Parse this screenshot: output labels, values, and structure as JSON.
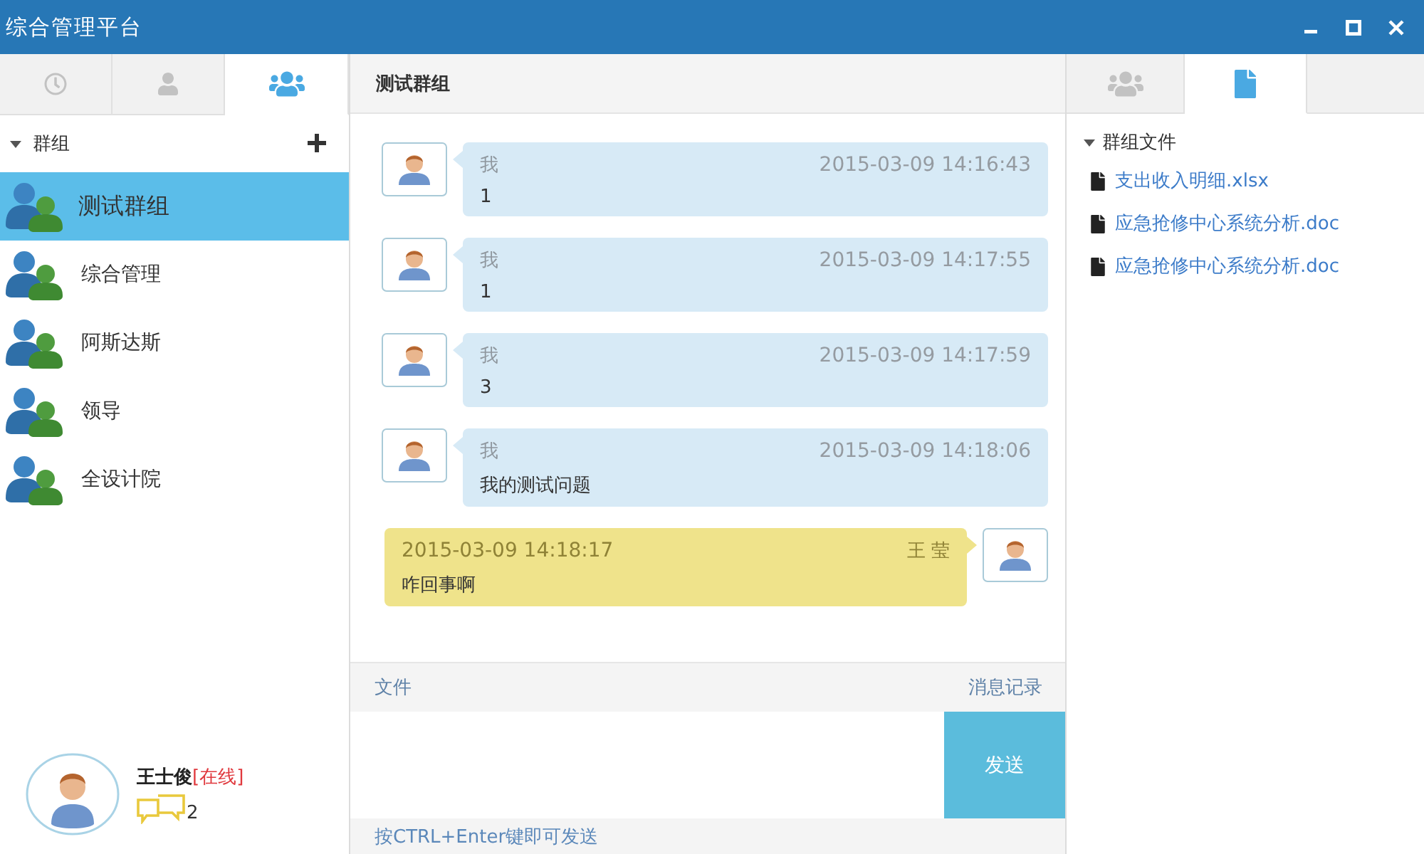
{
  "window": {
    "title": "综合管理平台"
  },
  "sidebar": {
    "tabs": [
      {
        "selected": false
      },
      {
        "selected": false
      },
      {
        "selected": true
      }
    ],
    "section": {
      "label": "群组",
      "expanded": true
    },
    "groups": [
      {
        "name": "测试群组",
        "selected": true
      },
      {
        "name": "综合管理",
        "selected": false
      },
      {
        "name": "阿斯达斯",
        "selected": false
      },
      {
        "name": "领导",
        "selected": false
      },
      {
        "name": "全设计院",
        "selected": false
      }
    ]
  },
  "current_user": {
    "name": "王士俊",
    "status": "[在线]",
    "unread": "2"
  },
  "chat": {
    "title": "测试群组",
    "messages": [
      {
        "kind": "sent",
        "sender": "我",
        "time": "2015-03-09 14:16:43",
        "text": "1"
      },
      {
        "kind": "sent",
        "sender": "我",
        "time": "2015-03-09 14:17:55",
        "text": "1"
      },
      {
        "kind": "sent",
        "sender": "我",
        "time": "2015-03-09 14:17:59",
        "text": "3"
      },
      {
        "kind": "sent",
        "sender": "我",
        "time": "2015-03-09 14:18:06",
        "text": "我的测试问题"
      },
      {
        "kind": "received",
        "sender": "王 莹",
        "time": "2015-03-09 14:18:17",
        "text": "咋回事啊"
      }
    ],
    "toolbar": {
      "files": "文件",
      "history": "消息记录"
    },
    "send_button": "发送",
    "hint": "按CTRL+Enter键即可发送"
  },
  "files_panel": {
    "tabs": [
      {
        "selected": false
      },
      {
        "selected": true
      }
    ],
    "section": {
      "label": "群组文件",
      "expanded": true
    },
    "files": [
      "支出收入明细.xlsx",
      "应急抢修中心系统分析.doc",
      "应急抢修中心系统分析.doc"
    ]
  }
}
